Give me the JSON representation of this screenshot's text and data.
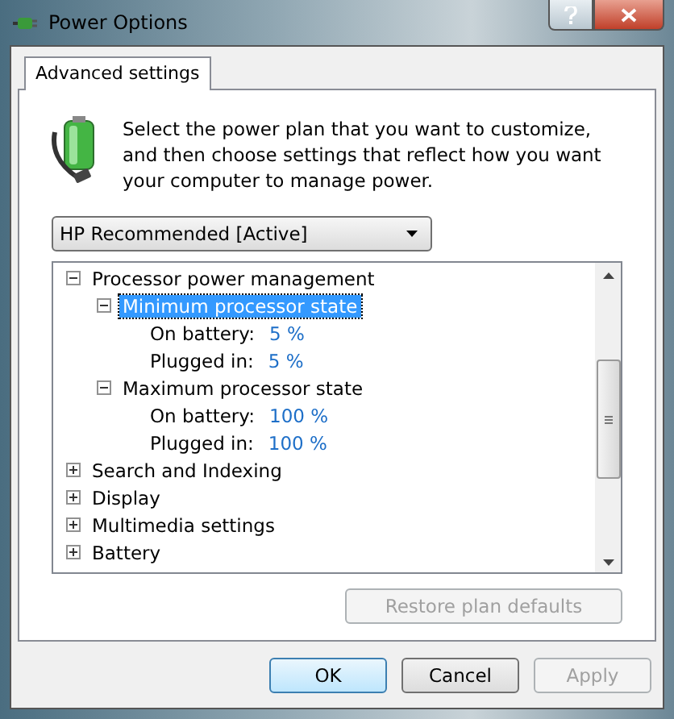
{
  "window": {
    "title": "Power Options"
  },
  "tabs": [
    {
      "label": "Advanced settings",
      "selected": true
    }
  ],
  "description": "Select the power plan that you want to customize, and then choose settings that reflect how you want your computer to manage power.",
  "plan_dropdown": {
    "value": "HP Recommended [Active]"
  },
  "tree": [
    {
      "kind": "group",
      "label": "Processor power management",
      "expanded": true,
      "selected": false,
      "children": [
        {
          "kind": "group",
          "label": "Minimum processor state",
          "expanded": true,
          "selected": true,
          "children": [
            {
              "kind": "setting",
              "label": "On battery:",
              "value": "5 %"
            },
            {
              "kind": "setting",
              "label": "Plugged in:",
              "value": "5 %"
            }
          ]
        },
        {
          "kind": "group",
          "label": "Maximum processor state",
          "expanded": true,
          "selected": false,
          "children": [
            {
              "kind": "setting",
              "label": "On battery:",
              "value": "100 %"
            },
            {
              "kind": "setting",
              "label": "Plugged in:",
              "value": "100 %"
            }
          ]
        }
      ]
    },
    {
      "kind": "group",
      "label": "Search and Indexing",
      "expanded": false,
      "selected": false
    },
    {
      "kind": "group",
      "label": "Display",
      "expanded": false,
      "selected": false
    },
    {
      "kind": "group",
      "label": "Multimedia settings",
      "expanded": false,
      "selected": false
    },
    {
      "kind": "group",
      "label": "Battery",
      "expanded": false,
      "selected": false
    }
  ],
  "restore_button": {
    "label": "Restore plan defaults",
    "disabled": true
  },
  "buttons": [
    {
      "label": "OK",
      "default": true,
      "disabled": false
    },
    {
      "label": "Cancel",
      "default": false,
      "disabled": false
    },
    {
      "label": "Apply",
      "default": false,
      "disabled": true
    }
  ]
}
